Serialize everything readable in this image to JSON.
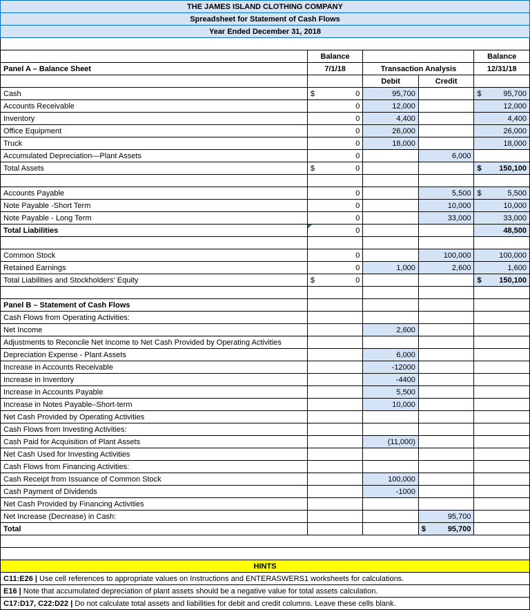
{
  "title": {
    "line1": "THE JAMES ISLAND CLOTHING COMPANY",
    "line2": "Spreadsheet for Statement of Cash Flows",
    "line3": "Year Ended December 31, 2018"
  },
  "cols": {
    "balance": "Balance",
    "balance_date1": "7/1/18",
    "trans": "Transaction Analysis",
    "debit": "Debit",
    "credit": "Credit",
    "balance_date2": "12/31/18"
  },
  "panelA": {
    "heading": "Panel A – Balance Sheet",
    "rows": [
      {
        "label": "Cash",
        "bal1_sym": "$",
        "bal1": "0",
        "debit": "95,700",
        "credit": "",
        "bal2_sym": "$",
        "bal2": "95,700"
      },
      {
        "label": "Accounts Receivable",
        "bal1_sym": "",
        "bal1": "0",
        "debit": "12,000",
        "credit": "",
        "bal2_sym": "",
        "bal2": "12,000"
      },
      {
        "label": "Inventory",
        "bal1_sym": "",
        "bal1": "0",
        "debit": "4,400",
        "credit": "",
        "bal2_sym": "",
        "bal2": "4,400"
      },
      {
        "label": "Office Equipment",
        "bal1_sym": "",
        "bal1": "0",
        "debit": "26,000",
        "credit": "",
        "bal2_sym": "",
        "bal2": "26,000"
      },
      {
        "label": "Truck",
        "bal1_sym": "",
        "bal1": "0",
        "debit": "18,000",
        "credit": "",
        "bal2_sym": "",
        "bal2": "18,000"
      },
      {
        "label": "Accumulated Depreciation—Plant Assets",
        "bal1_sym": "",
        "bal1": "0",
        "debit": "",
        "credit": "6,000",
        "bal2_sym": "",
        "bal2": ""
      },
      {
        "label": "Total Assets",
        "bal1_sym": "$",
        "bal1": "0",
        "debit": "",
        "credit": "",
        "bal2_sym": "$",
        "bal2": "150,100",
        "total": true
      }
    ],
    "liab": [
      {
        "label": "Accounts Payable",
        "bal1_sym": "",
        "bal1": "0",
        "debit": "",
        "credit": "5,500",
        "bal2_sym": "$",
        "bal2": "5,500"
      },
      {
        "label": "Note Payable -Short Term",
        "bal1_sym": "",
        "bal1": "0",
        "debit": "",
        "credit": "10,000",
        "bal2_sym": "",
        "bal2": "10,000"
      },
      {
        "label": "Note Payable - Long Term",
        "bal1_sym": "",
        "bal1": "0",
        "debit": "",
        "credit": "33,000",
        "bal2_sym": "",
        "bal2": "33,000"
      },
      {
        "label": "Total Liabilities",
        "bal1_sym": "",
        "bal1": "0",
        "debit": "",
        "credit": "",
        "bal2_sym": "",
        "bal2": "48,500",
        "total": true,
        "bold": true,
        "green": true
      }
    ],
    "equity": [
      {
        "label": "Common Stock",
        "bal1_sym": "",
        "bal1": "0",
        "debit": "",
        "credit": "100,000",
        "bal2_sym": "",
        "bal2": "100,000"
      },
      {
        "label": "Retained Earnings",
        "bal1_sym": "",
        "bal1": "0",
        "debit": "1,000",
        "credit": "2,600",
        "bal2_sym": "",
        "bal2": "1,600"
      },
      {
        "label": "Total Liabilities and Stockholders' Equity",
        "bal1_sym": "$",
        "bal1": "0",
        "debit": "",
        "credit": "",
        "bal2_sym": "$",
        "bal2": "150,100",
        "total": true
      }
    ]
  },
  "panelB": {
    "heading": "Panel B – Statement of Cash Flows",
    "rows": [
      {
        "label": "Cash Flows from Operating Activities:"
      },
      {
        "label": "Net Income",
        "debit": "2,600"
      },
      {
        "label": "Adjustments to Reconcile Net Income to Net Cash Provided by Operating Activities"
      },
      {
        "label": "Depreciation Expense - Plant Assets",
        "debit": "6,000"
      },
      {
        "label": "Increase in Accounts Receivable",
        "debit": "-12000"
      },
      {
        "label": "Increase in Inventory",
        "debit": "-4400"
      },
      {
        "label": "Increase in Accounts Payable",
        "debit": "5,500"
      },
      {
        "label": "Increase in Notes Payable–Short-term",
        "debit": "10,000"
      },
      {
        "label": "Net Cash Provided by Operating Activities"
      },
      {
        "label": "Cash Flows from Investing Activities:"
      },
      {
        "label": "Cash Paid for Acquisition of Plant Assets",
        "debit": "(11,000)"
      },
      {
        "label": "Net Cash Used for Investing Activities"
      },
      {
        "label": "Cash Flows from Financing Activities:"
      },
      {
        "label": "Cash Receipt from Issuance of Common Stock",
        "debit": "100,000"
      },
      {
        "label": "Cash Payment of Dividends",
        "debit": "-1000"
      },
      {
        "label": "Net Cash Provided by Financing Activities"
      },
      {
        "label": "Net Increase (Decrease) in Cash:",
        "credit": "95,700"
      },
      {
        "label": "Total",
        "bold": true,
        "credit": "95,700",
        "credit_sym": "$",
        "total": true
      }
    ]
  },
  "hints": {
    "heading": "HINTS",
    "lines": [
      {
        "prefix": "C11:E26 | ",
        "text": "Use cell references to appropriate values on Instructions and ENTERASWERS1 worksheets for calculations."
      },
      {
        "prefix": "E16 | ",
        "text": "Note that accumulated depreciation of plant assets should be a negative value for total assets calculation."
      },
      {
        "prefix": "C17:D17, C22:D22 | ",
        "text": "Do not calculate total assets and liabilities for debit and credit columns. Leave these cells blank."
      }
    ]
  }
}
